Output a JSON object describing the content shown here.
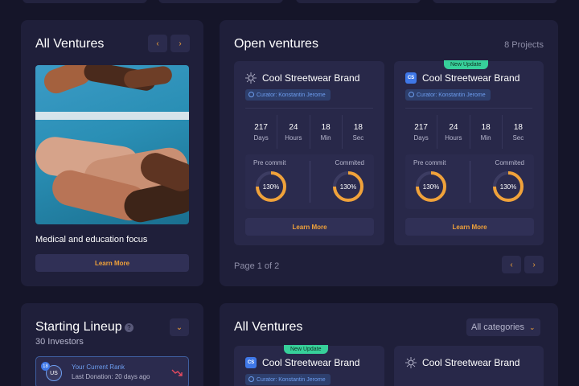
{
  "all_ventures_panel": {
    "title": "All Ventures",
    "caption": "Medical and education focus",
    "learn_more": "Learn More",
    "prev_glyph": "‹",
    "next_glyph": "›"
  },
  "open_ventures": {
    "title": "Open ventures",
    "count": "8 Projects",
    "pagination": "Page 1 of 2",
    "prev_glyph": "‹",
    "next_glyph": "›",
    "cards": [
      {
        "title": "Cool Streetwear Brand",
        "logo": "mandala-icon",
        "logo_text": "",
        "badge": "",
        "curator": "Curator: Konstantin Jerome",
        "days": "217",
        "hours": "24",
        "min": "18",
        "sec": "18",
        "days_label": "Days",
        "hours_label": "Hours",
        "min_label": "Min",
        "sec_label": "Sec",
        "pre_commit_label": "Pre commit",
        "pre_commit_value": "130%",
        "committed_label": "Commited",
        "committed_value": "130%",
        "learn_more": "Learn More"
      },
      {
        "title": "Cool Streetwear Brand",
        "logo": "cs-logo",
        "logo_text": "CS",
        "badge": "New Update",
        "curator": "Curator: Konstantin Jerome",
        "days": "217",
        "hours": "24",
        "min": "18",
        "sec": "18",
        "days_label": "Days",
        "hours_label": "Hours",
        "min_label": "Min",
        "sec_label": "Sec",
        "pre_commit_label": "Pre commit",
        "pre_commit_value": "130%",
        "committed_label": "Commited",
        "committed_value": "130%",
        "learn_more": "Learn More"
      }
    ]
  },
  "starting_lineup": {
    "title": "Starting Lineup",
    "help_glyph": "?",
    "subtitle": "30 Investors",
    "expand_glyph": "⌄",
    "rank_badge": "18",
    "avatar_initials": "US",
    "rank_title": "Your Current Rank",
    "last_donation": "Last Donation: 20 days ago"
  },
  "all_ventures_bottom": {
    "title": "All Ventures",
    "filter": "All categories",
    "filter_glyph": "⌄",
    "cards": [
      {
        "title": "Cool Streetwear Brand",
        "logo": "cs-logo",
        "logo_text": "CS",
        "badge": "New Update",
        "curator": "Curator: Konstantin Jerome"
      },
      {
        "title": "Cool Streetwear Brand",
        "logo": "mandala-icon",
        "logo_text": "",
        "badge": "",
        "curator": ""
      }
    ]
  },
  "colors": {
    "background": "#151529",
    "panel": "#1f1f3a",
    "card": "#282849",
    "accent_orange": "#f0a23a",
    "badge_green": "#37d09a",
    "curator_blue": "#6d9ef0"
  }
}
